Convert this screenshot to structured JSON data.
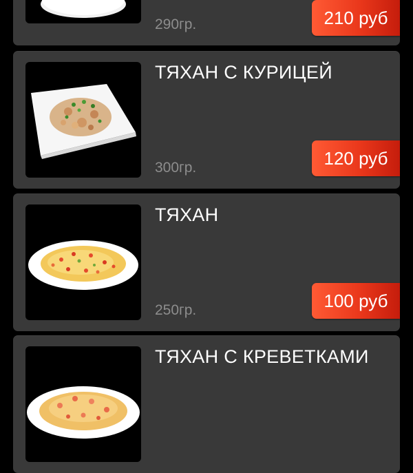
{
  "items": [
    {
      "title": "",
      "weight": "290гр.",
      "price": "210 руб",
      "image": "bowl-image"
    },
    {
      "title": "ТЯХАН С КУРИЦЕЙ",
      "weight": "300гр.",
      "price": "120 руб",
      "image": "chicken-rice-plate-image"
    },
    {
      "title": "ТЯХАН",
      "weight": "250гр.",
      "price": "100 руб",
      "image": "fried-rice-plate-image"
    },
    {
      "title": "ТЯХАН С КРЕВЕТКАМИ",
      "weight": "",
      "price": "",
      "image": "shrimp-rice-plate-image"
    }
  ],
  "colors": {
    "background": "#000000",
    "card": "#393939",
    "price_badge": "#e9371b",
    "weight_text": "#8d8d8d"
  }
}
